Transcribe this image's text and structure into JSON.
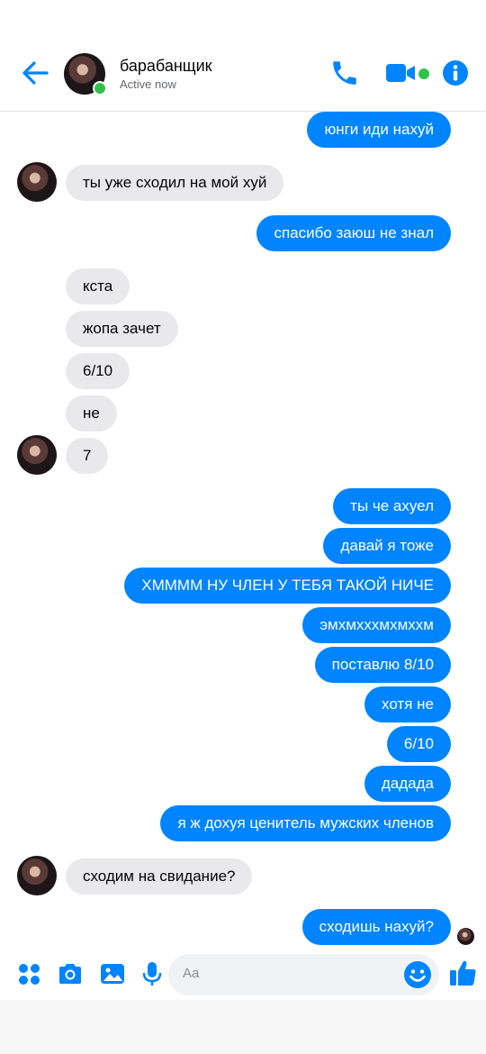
{
  "header": {
    "contact_name": "барабанщик",
    "status": "Active now",
    "accent_color": "#0084ff",
    "online_color": "#31c24d",
    "icons": [
      "back-arrow-icon",
      "phone-icon",
      "video-camera-icon",
      "info-icon"
    ]
  },
  "messages": [
    {
      "dir": "out",
      "text": "юнги иди нахуй"
    },
    {
      "dir": "in",
      "text": "ты уже сходил на мой хуй"
    },
    {
      "dir": "out",
      "text": "спасибо заюш не знал"
    },
    {
      "dir": "in",
      "text": "кста"
    },
    {
      "dir": "in",
      "text": "жопа зачет"
    },
    {
      "dir": "in",
      "text": "6/10"
    },
    {
      "dir": "in",
      "text": "не"
    },
    {
      "dir": "in",
      "text": "7"
    },
    {
      "dir": "out",
      "text": "ты че ахуел"
    },
    {
      "dir": "out",
      "text": "давай я тоже"
    },
    {
      "dir": "out",
      "text": "ХММММ НУ ЧЛЕН У ТЕБЯ ТАКОЙ НИЧЕ"
    },
    {
      "dir": "out",
      "text": "эмхмхххмхмххм"
    },
    {
      "dir": "out",
      "text": "поставлю 8/10"
    },
    {
      "dir": "out",
      "text": "хотя не"
    },
    {
      "dir": "out",
      "text": "6/10"
    },
    {
      "dir": "out",
      "text": "дадада"
    },
    {
      "dir": "out",
      "text": "я ж дохуя ценитель мужских членов"
    },
    {
      "dir": "in",
      "text": "сходим на свидание?"
    },
    {
      "dir": "out",
      "text": "сходишь нахуй?"
    }
  ],
  "composer": {
    "placeholder": "Aa",
    "icons": [
      "apps-grid-icon",
      "camera-icon",
      "gallery-icon",
      "microphone-icon",
      "emoji-icon",
      "thumbs-up-icon"
    ]
  }
}
